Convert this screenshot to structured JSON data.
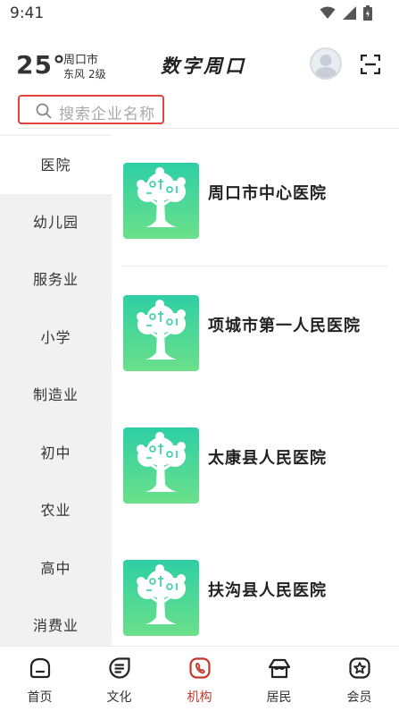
{
  "status_bar": {
    "time": "9:41"
  },
  "header": {
    "temperature": "25°",
    "city": "周口市",
    "wind_dir": "东风",
    "wind_level": "2级",
    "title": "数字周口"
  },
  "search": {
    "placeholder": "搜索企业名称"
  },
  "categories": [
    {
      "label": "医院",
      "active": true
    },
    {
      "label": "幼儿园"
    },
    {
      "label": "服务业"
    },
    {
      "label": "小学"
    },
    {
      "label": "制造业"
    },
    {
      "label": "初中"
    },
    {
      "label": "农业"
    },
    {
      "label": "高中"
    },
    {
      "label": "消费业"
    }
  ],
  "organizations": [
    {
      "name": "周口市中心医院"
    },
    {
      "name": "项城市第一人民医院"
    },
    {
      "name": "太康县人民医院"
    },
    {
      "name": "扶沟县人民医院"
    }
  ],
  "tabs": [
    {
      "label": "首页",
      "icon": "home-icon"
    },
    {
      "label": "文化",
      "icon": "culture-icon"
    },
    {
      "label": "机构",
      "icon": "institution-icon",
      "active": true
    },
    {
      "label": "居民",
      "icon": "resident-icon"
    },
    {
      "label": "会员",
      "icon": "member-icon"
    }
  ],
  "colors": {
    "accent": "#c0392b",
    "search_border": "#e0453a",
    "logo_gradient_top": "#2ecfa5",
    "logo_gradient_bottom": "#6be08a"
  }
}
